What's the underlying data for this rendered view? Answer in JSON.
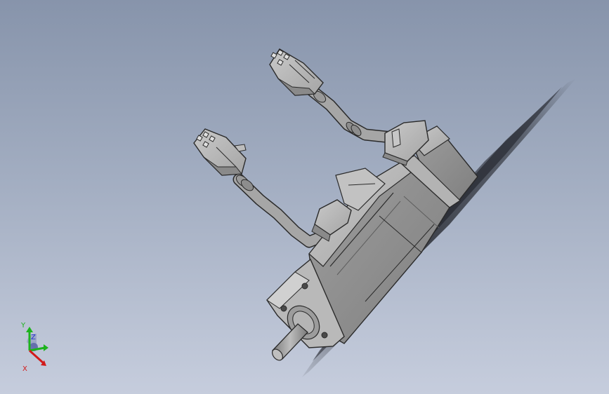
{
  "viewport": {
    "background_top": "#8794ab",
    "background_bottom": "#c6cddd"
  },
  "model": {
    "icon": "servo-motor-model",
    "body_color": "#a9a9a9",
    "edge_color": "#2a2a2a"
  },
  "triad": {
    "y_label": "Y",
    "x_label": "X",
    "z_label": "Z",
    "y_color": "#1db31d",
    "x_color": "#d21a1a",
    "z_color": "#2233cc"
  }
}
